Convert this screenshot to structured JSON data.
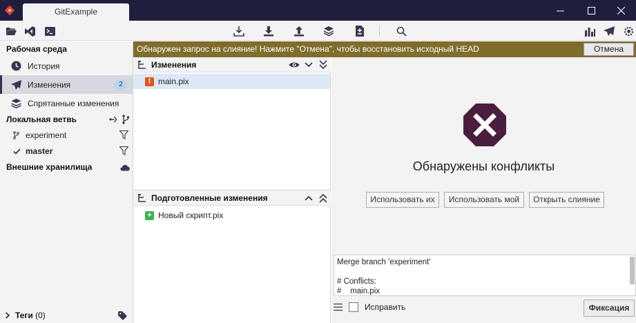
{
  "titlebar": {
    "tab_title": "GitExample",
    "colors": {
      "background": "#1f1f3d",
      "logo": "#e04a2f"
    }
  },
  "toolbar": {
    "left_icons": [
      "folder-icon",
      "vscode-icon",
      "terminal-icon"
    ],
    "center_icons": [
      "fetch-icon",
      "pull-icon",
      "push-icon",
      "stash-icon",
      "apply-patch-icon",
      "search-icon"
    ],
    "right_icons": [
      "statistics-icon",
      "hotkey-icon",
      "settings-icon"
    ]
  },
  "sidebar": {
    "workspace_title": "Рабочая среда",
    "items": [
      {
        "label": "История",
        "icon": "history-icon"
      },
      {
        "label": "Изменения",
        "icon": "send-icon",
        "badge": "2",
        "active": true
      },
      {
        "label": "Спрятанные изменения",
        "icon": "stash-icon"
      }
    ],
    "local_branches_title": "Локальная ветвь",
    "branches": [
      {
        "name": "experiment",
        "current": false
      },
      {
        "name": "master",
        "current": true
      }
    ],
    "remotes_title": "Внешние хранилища",
    "tags_title": "Теги",
    "tags_count": "(0)"
  },
  "notice": {
    "message": "Обнаружен запрос на слияние! Нажмите \"Отмена\", чтобы восстановить исходный HEAD",
    "abort_label": "Отмена",
    "color": "#7f6d2c"
  },
  "unstaged": {
    "title": "Изменения",
    "files": [
      {
        "name": "main.pix",
        "status": "conflict",
        "badge": "!"
      }
    ],
    "color": "#e0541e"
  },
  "staged": {
    "title": "Подготовленные изменения",
    "files": [
      {
        "name": "Новый скрипт.pix",
        "status": "added",
        "badge": "+"
      }
    ],
    "color": "#3fb34a"
  },
  "conflict": {
    "title": "Обнаружены конфликты",
    "use_theirs_label": "Использовать их",
    "use_mine_label": "Использовать мой",
    "open_merge_label": "Открыть слияние",
    "icon_color": "#4a1e3e"
  },
  "commit": {
    "message_lines": [
      "Merge branch 'experiment'",
      "",
      "# Conflicts:",
      "#\tmain.pix"
    ],
    "amend_label": "Исправить",
    "commit_label": "Фиксация"
  }
}
